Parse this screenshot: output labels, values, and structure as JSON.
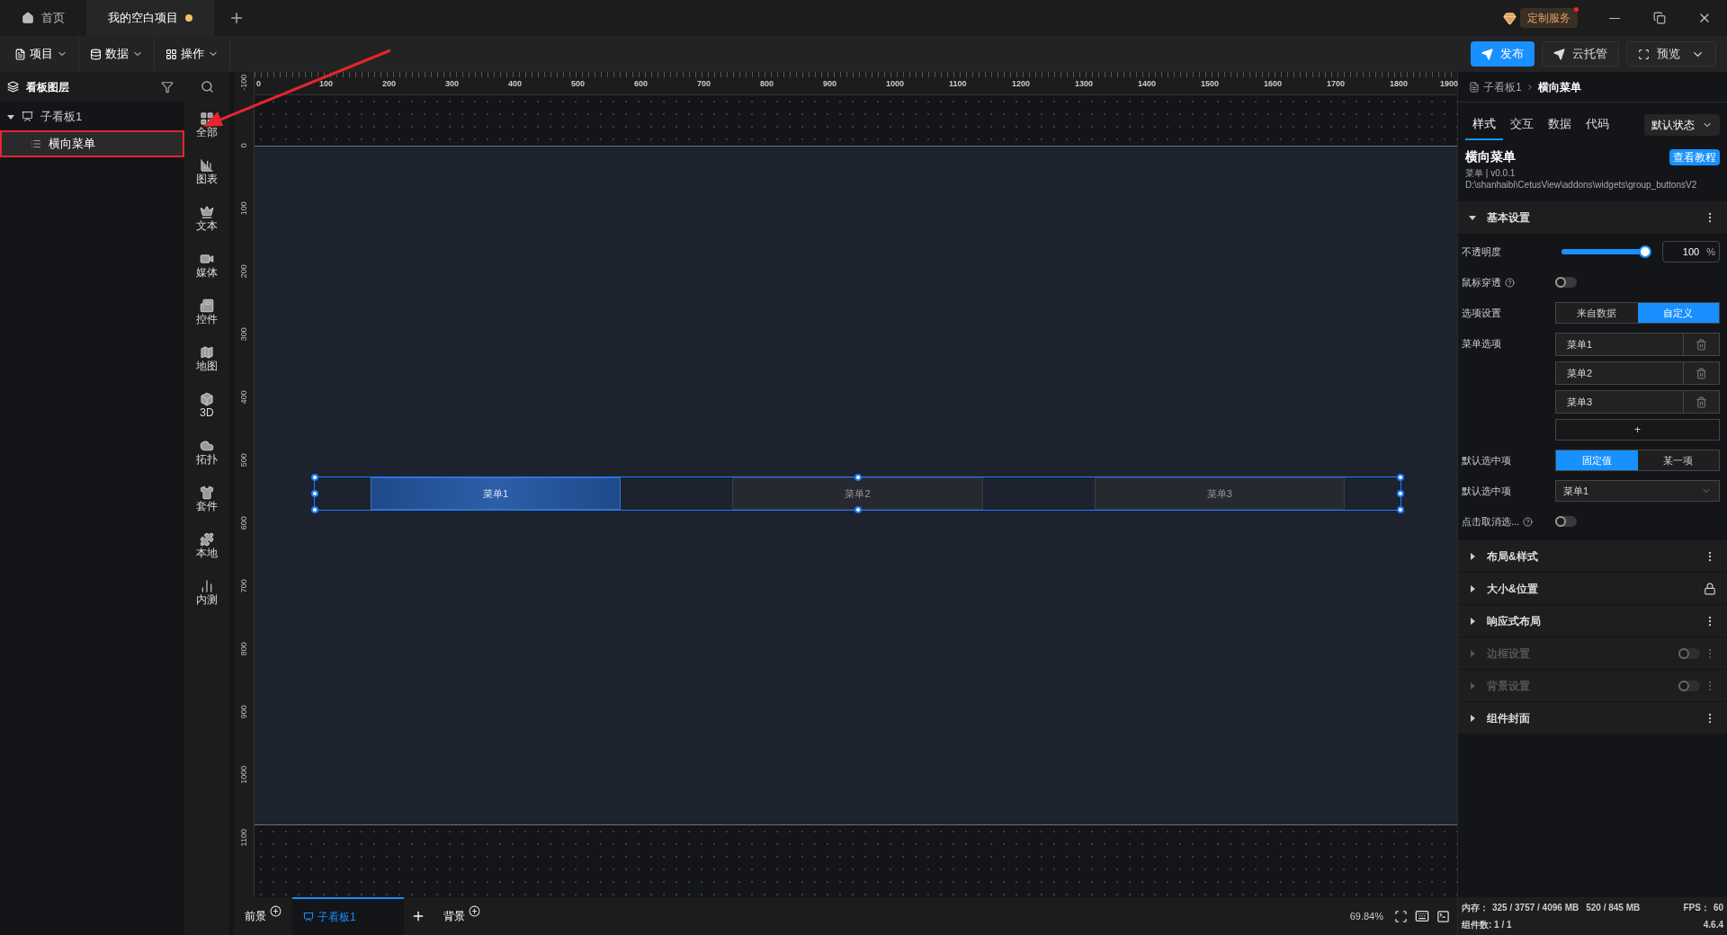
{
  "tabs": [
    {
      "label": "首页",
      "kind": "home",
      "selected": false,
      "unsaved": false
    },
    {
      "label": "我的空白项目",
      "kind": "project",
      "selected": true,
      "unsaved": true
    }
  ],
  "custom_service": "定制服务",
  "menus": [
    "项目",
    "数据",
    "操作"
  ],
  "actions": [
    {
      "label": "发布",
      "kind": "primary"
    },
    {
      "label": "云托管",
      "kind": "plain"
    },
    {
      "label": "预览",
      "kind": "dropdown"
    }
  ],
  "layers": {
    "title": "看板图层",
    "tree": [
      {
        "label": "子看板1",
        "expanded": true,
        "selected": false,
        "children": [
          {
            "label": "横向菜单",
            "selected": true,
            "highlighted": true
          }
        ]
      }
    ]
  },
  "categories": [
    {
      "label": "全部",
      "kind": "all"
    },
    {
      "label": "图表",
      "kind": "chart"
    },
    {
      "label": "文本",
      "kind": "text"
    },
    {
      "label": "媒体",
      "kind": "media"
    },
    {
      "label": "控件",
      "kind": "control"
    },
    {
      "label": "地图",
      "kind": "map"
    },
    {
      "label": "3D",
      "kind": "cube"
    },
    {
      "label": "拓扑",
      "kind": "topology"
    },
    {
      "label": "套件",
      "kind": "kit"
    },
    {
      "label": "本地",
      "kind": "local"
    },
    {
      "label": "内测",
      "kind": "beta"
    }
  ],
  "rulers": {
    "horizontal": [
      "0",
      "100",
      "200",
      "300",
      "400",
      "500",
      "600",
      "700",
      "800",
      "900",
      "1000",
      "1100",
      "1200",
      "1300",
      "1400",
      "1500",
      "1600",
      "1700",
      "1800",
      "1900"
    ],
    "vertical": [
      "-100",
      "0",
      "100",
      "200",
      "300",
      "400",
      "500",
      "600",
      "700",
      "800",
      "900",
      "1000",
      "1100"
    ]
  },
  "canvas": {
    "menu": {
      "items": [
        {
          "label": "菜单1",
          "selected": true
        },
        {
          "label": "菜单2",
          "selected": false
        },
        {
          "label": "菜单3",
          "selected": false
        }
      ]
    }
  },
  "bottom": {
    "tabs": [
      {
        "label": "前景",
        "kind": "layer",
        "selected": false
      },
      {
        "label": "子看板1",
        "kind": "board",
        "selected": true
      },
      {
        "label": "背景",
        "kind": "layer",
        "selected": false
      }
    ],
    "zoom": "69.84%"
  },
  "inspector": {
    "breadcrumb": [
      "子看板1",
      "横向菜单"
    ],
    "tabs": [
      {
        "label": "样式",
        "selected": true
      },
      {
        "label": "交互",
        "selected": false
      },
      {
        "label": "数据",
        "selected": false
      },
      {
        "label": "代码",
        "selected": false
      }
    ],
    "state_select": "默认状态",
    "widget": {
      "name": "横向菜单",
      "meta": "菜单 | v0.0.1",
      "path": "D:\\shanhaibi\\CetusView\\addons\\widgets\\group_buttonsV2",
      "tutorial": "查看教程"
    },
    "basic": {
      "title": "基本设置",
      "expanded": true
    },
    "props": [
      {
        "kind": "slider",
        "label": "不透明度",
        "level": 1,
        "value": "100",
        "unit": "%"
      },
      {
        "kind": "toggle",
        "label": "鼠标穿透",
        "help": true,
        "on": false
      },
      {
        "kind": "segmented",
        "label": "选项设置",
        "options": [
          {
            "label": "来自数据",
            "selected": false
          },
          {
            "label": "自定义",
            "selected": true
          }
        ]
      },
      {
        "kind": "list",
        "label": "菜单选项",
        "items": [
          "菜单1",
          "菜单2",
          "菜单3"
        ],
        "add": "+"
      },
      {
        "kind": "segmented",
        "label": "默认选中项",
        "options": [
          {
            "label": "固定值",
            "selected": true
          },
          {
            "label": "某一项",
            "selected": false
          }
        ]
      },
      {
        "kind": "select",
        "label": "默认选中项",
        "value": "菜单1"
      },
      {
        "kind": "toggle",
        "label": "点击取消选...",
        "help": true,
        "on": false
      }
    ],
    "sections": [
      {
        "title": "布局&样式",
        "disabled": false,
        "kind": "menu"
      },
      {
        "title": "大小&位置",
        "disabled": false,
        "kind": "locked"
      },
      {
        "title": "响应式布局",
        "disabled": false,
        "kind": "menu"
      },
      {
        "title": "边框设置",
        "disabled": true,
        "kind": "switchable",
        "on": false
      },
      {
        "title": "背景设置",
        "disabled": true,
        "kind": "switchable",
        "on": false
      },
      {
        "title": "组件封面",
        "disabled": false,
        "kind": "menu"
      }
    ]
  },
  "status": {
    "memory_label": "内存：",
    "memory": [
      "325 / 3757 / 4096 MB",
      "520 / 845 MB"
    ],
    "fps_label": "FPS：",
    "fps": "60",
    "components": "组件数: 1 / 1",
    "version": "4.6.4"
  }
}
